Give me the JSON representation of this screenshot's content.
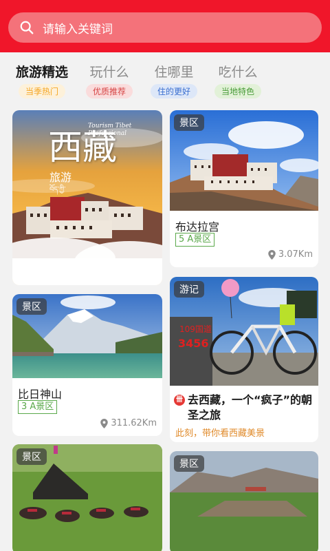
{
  "search": {
    "placeholder": "请输入关键词"
  },
  "tabs": [
    {
      "label": "旅游精选",
      "tag": "当季热门",
      "tag_color": "#f5a623",
      "tag_bg": "#fdf1da"
    },
    {
      "label": "玩什么",
      "tag": "优质推荐",
      "tag_color": "#d64545",
      "tag_bg": "#fadcdc"
    },
    {
      "label": "住哪里",
      "tag": "住的更好",
      "tag_color": "#3a6fd0",
      "tag_bg": "#dde7f8"
    },
    {
      "label": "吃什么",
      "tag": "当地特色",
      "tag_color": "#4a9c3a",
      "tag_bg": "#e2f1d8"
    }
  ],
  "feature": {
    "title": "西藏",
    "subtitle": "旅游",
    "tibetan": "བོད་ཀྱི་",
    "english": "Tourism Tibet Professional"
  },
  "cards": [
    {
      "badge": "景区",
      "title": "布达拉宫",
      "level": "5 A景区",
      "distance": "3.07Km"
    },
    {
      "badge": "景区",
      "title": "比日神山",
      "level": "3 A景区",
      "distance": "311.62Km"
    },
    {
      "badge": "游记",
      "title": "去西藏，一个“疯子”的朝圣之旅",
      "subtitle": "此刻，带你看西藏美景",
      "mark": "卌"
    },
    {
      "badge": "景区"
    },
    {
      "badge": "景区"
    }
  ],
  "colors": {
    "brand": "#f0162a",
    "level_green": "#5aa84a"
  }
}
